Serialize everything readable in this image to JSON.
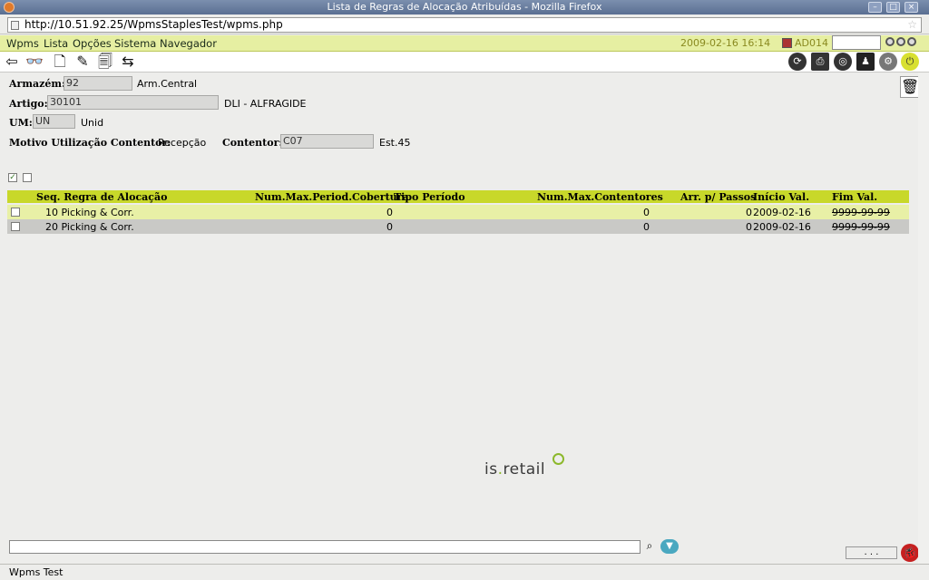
{
  "window": {
    "title": "Lista de Regras de Alocação Atribuídas - Mozilla Firefox"
  },
  "browser": {
    "url": "http://10.51.92.25/WpmsStaplesTest/wpms.php"
  },
  "menu": {
    "items": [
      "Wpms",
      "Lista",
      "Opções",
      "Sistema",
      "Navegador"
    ],
    "datetime": "2009-02-16  16:14",
    "user": "AD014"
  },
  "form": {
    "armazem_label": "Armazém:",
    "armazem_value": "92",
    "armazem_desc": "Arm.Central",
    "artigo_label": "Artigo:",
    "artigo_value": "30101",
    "artigo_desc": "DLI - ALFRAGIDE",
    "um_label": "UM:",
    "um_value": "UN",
    "um_desc": "Unid",
    "motivo_label": "Motivo Utilização Contentor:",
    "motivo_value": "Recepção",
    "contentor_label": "Contentor:",
    "contentor_value": "C07",
    "contentor_desc": "Est.45"
  },
  "grid": {
    "headers": [
      "Seq. Regra de Alocação",
      "Num.Max.Period.Cobertura",
      "Tipo Período",
      "Num.Max.Contentores",
      "Arr. p/ Passos",
      "Início Val.",
      "Fim Val."
    ],
    "rows": [
      {
        "seq": "10 Picking & Corr.",
        "max_period": "0",
        "tipo": "",
        "max_cont": "0",
        "arr": "0",
        "inicio": "2009-02-16",
        "fim": "9999-99-99"
      },
      {
        "seq": "20 Picking & Corr.",
        "max_period": "0",
        "tipo": "",
        "max_cont": "0",
        "arr": "0",
        "inicio": "2009-02-16",
        "fim": "9999-99-99"
      }
    ]
  },
  "logo": {
    "text_a": "is",
    "text_b": ".",
    "text_c": "retail"
  },
  "footer": {
    "dots_label": ". . .",
    "status": "Wpms Test"
  },
  "colors": {
    "menu_bg": "#e6efa2",
    "header_bg": "#c8d82a",
    "row1_bg": "#e8f0a6",
    "row2_bg": "#c9c9c6",
    "accent": "#8cb82a"
  }
}
